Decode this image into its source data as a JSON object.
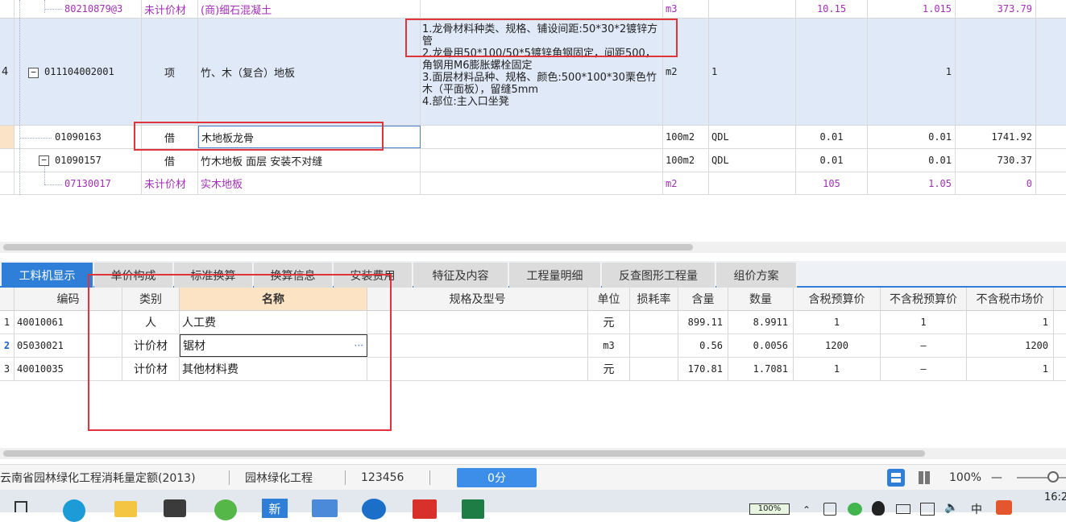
{
  "top_table": {
    "rows": [
      {
        "num": "",
        "code": "80210879@3",
        "type": "未计价材",
        "name": "(商)细石混凝土",
        "unit": "m3",
        "expr": "",
        "qty1": "10.15",
        "qty2": "1.015",
        "price": "373.79",
        "purple": true
      },
      {
        "num": "4",
        "code": "011104002001",
        "type": "项",
        "name": "竹、木（复合）地板",
        "desc": [
          "1.龙骨材料种类、规格、铺设间距:50*30*2镀锌方管",
          "2.龙骨用50*100/50*5镀锌角钢固定，间距500，角钢用M6膨胀螺栓固定",
          "3.面层材料品种、规格、颜色:500*100*30栗色竹木（平面板），留缝5mm",
          "4.部位:主入口坐凳"
        ],
        "unit": "m2",
        "expr": "1",
        "qty1": "",
        "qty2": "1",
        "price": ""
      },
      {
        "num": "",
        "code": "01090163",
        "type": "借",
        "name": "木地板龙骨",
        "unit": "100m2",
        "expr": "QDL",
        "qty1": "0.01",
        "qty2": "0.01",
        "price": "1741.92"
      },
      {
        "num": "",
        "code": "01090157",
        "type": "借",
        "name": "竹木地板 面层 安装不对缝",
        "unit": "100m2",
        "expr": "QDL",
        "qty1": "0.01",
        "qty2": "0.01",
        "price": "730.37"
      },
      {
        "num": "",
        "code": "07130017",
        "type": "未计价材",
        "name": "实木地板",
        "unit": "m2",
        "expr": "",
        "qty1": "105",
        "qty2": "1.05",
        "price": "0",
        "purple": true
      }
    ]
  },
  "tabs": [
    "工料机显示",
    "单价构成",
    "标准换算",
    "换算信息",
    "安装费用",
    "特征及内容",
    "工程量明细",
    "反查图形工程量",
    "组价方案"
  ],
  "bottom_table": {
    "headers": {
      "code": "编码",
      "category": "类别",
      "name": "名称",
      "spec": "规格及型号",
      "unit": "单位",
      "loss": "损耗率",
      "content": "含量",
      "amount": "数量",
      "tax_price": "含税预算价",
      "notax_price": "不含税预算价",
      "market_price": "不含税市场价"
    },
    "rows": [
      {
        "num": "1",
        "code": "40010061",
        "category": "人",
        "name": "人工费",
        "spec": "",
        "unit": "元",
        "loss": "",
        "content": "899.11",
        "amount": "8.9911",
        "tax_price": "1",
        "notax_price": "1",
        "market_price": "1"
      },
      {
        "num": "2",
        "code": "05030021",
        "category": "计价材",
        "name": "锯材",
        "spec": "",
        "unit": "m3",
        "loss": "",
        "content": "0.56",
        "amount": "0.0056",
        "tax_price": "1200",
        "notax_price": "—",
        "market_price": "1200",
        "edit_more": "···"
      },
      {
        "num": "3",
        "code": "40010035",
        "category": "计价材",
        "name": "其他材料费",
        "spec": "",
        "unit": "元",
        "loss": "",
        "content": "170.81",
        "amount": "1.7081",
        "tax_price": "1",
        "notax_price": "—",
        "market_price": "1"
      }
    ]
  },
  "status_bar": {
    "quota": "云南省园林绿化工程消耗量定额(2013)",
    "project": "园林绿化工程",
    "code": "123456",
    "score": "0分",
    "zoom": "100%",
    "minus": "—"
  },
  "taskbar": {
    "battery": "100%",
    "clock": "16:2",
    "ime_label": "中",
    "app_label": "新"
  },
  "colors": {
    "accent": "#2f7fd8",
    "highlight_box": "#e0333a",
    "unpriced_material": "#a230b6",
    "selected_row": "#dfe9f7"
  }
}
